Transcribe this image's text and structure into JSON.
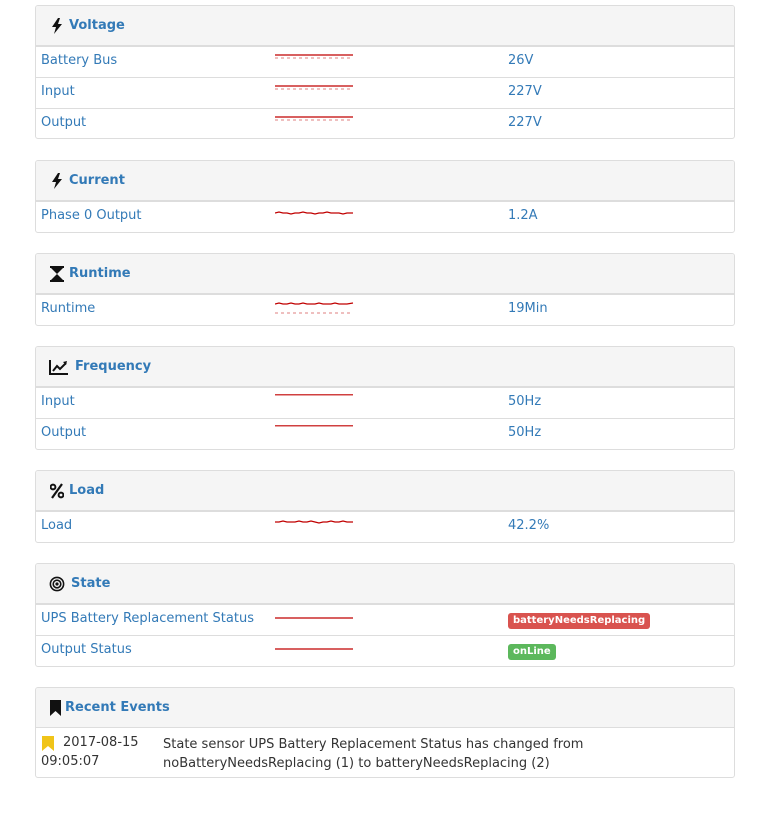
{
  "sections": {
    "voltage": {
      "title": "Voltage",
      "icon": "lightning-bolt-icon",
      "rows": [
        {
          "label": "Battery Bus",
          "value": "26V"
        },
        {
          "label": "Input",
          "value": "227V"
        },
        {
          "label": "Output",
          "value": "227V"
        }
      ]
    },
    "current": {
      "title": "Current",
      "icon": "lightning-bolt-icon",
      "rows": [
        {
          "label": "Phase 0 Output",
          "value": "1.2A"
        }
      ]
    },
    "runtime": {
      "title": "Runtime",
      "icon": "hourglass-icon",
      "rows": [
        {
          "label": "Runtime",
          "value": "19Min"
        }
      ]
    },
    "frequency": {
      "title": "Frequency",
      "icon": "line-chart-icon",
      "rows": [
        {
          "label": "Input",
          "value": "50Hz"
        },
        {
          "label": "Output",
          "value": "50Hz"
        }
      ]
    },
    "load": {
      "title": "Load",
      "icon": "percent-icon",
      "rows": [
        {
          "label": "Load",
          "value": "42.2%"
        }
      ]
    },
    "state": {
      "title": "State",
      "icon": "bullseye-icon",
      "rows": [
        {
          "label": "UPS Battery Replacement Status",
          "value": "batteryNeedsReplacing",
          "badge_color": "#d9534f"
        },
        {
          "label": "Output Status",
          "value": "onLine",
          "badge_color": "#5cb85c"
        }
      ]
    }
  },
  "events": {
    "title": "Recent Events",
    "icon": "bookmark-icon",
    "flag_color": "#f0c419",
    "items": [
      {
        "date": "2017-08-15",
        "time": "09:05:07",
        "message_line1": "State sensor UPS Battery Replacement Status has changed from",
        "message_line2": "noBatteryNeedsReplacing (1) to batteryNeedsReplacing (2)"
      }
    ]
  },
  "colors": {
    "link": "#337ab7",
    "sparkline": "#c00000",
    "heading_bg": "#f5f5f5",
    "border": "#dddddd"
  }
}
